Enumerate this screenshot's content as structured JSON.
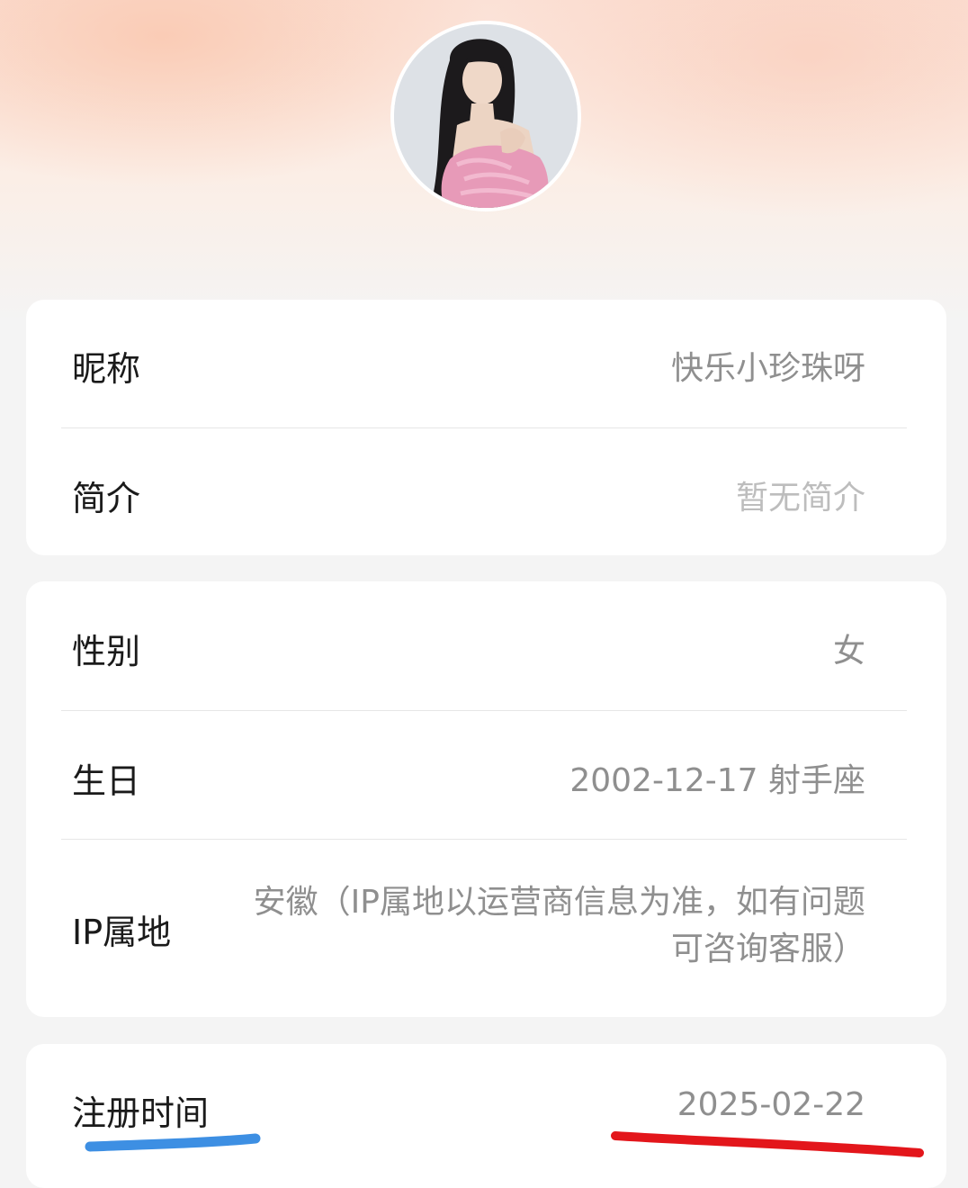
{
  "profile": {
    "fields": {
      "nickname": {
        "label": "昵称",
        "value": "快乐小珍珠呀"
      },
      "bio": {
        "label": "简介",
        "value": "暂无简介"
      },
      "gender": {
        "label": "性别",
        "value": "女"
      },
      "birthday": {
        "label": "生日",
        "value": "2002-12-17 射手座"
      },
      "ip_location": {
        "label": "IP属地",
        "value": "安徽（IP属地以运营商信息为准，如有问题可咨询客服）"
      },
      "register_time": {
        "label": "注册时间",
        "value": "2025-02-22"
      }
    }
  },
  "colors": {
    "label_underline": "#3d8fe3",
    "value_underline": "#e3161b"
  }
}
